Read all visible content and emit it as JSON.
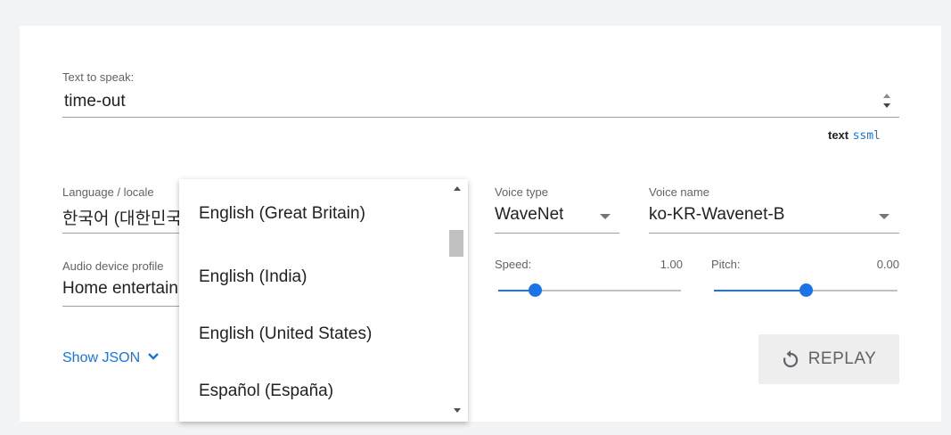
{
  "text_input": {
    "label": "Text to speak:",
    "value": "time-out",
    "mode_text": "text",
    "mode_ssml": "ssml"
  },
  "language": {
    "label": "Language / locale",
    "value": "한국어 (대한민국)"
  },
  "audio_profile": {
    "label": "Audio device profile",
    "value": "Home entertainment"
  },
  "voice_type": {
    "label": "Voice type",
    "value": "WaveNet"
  },
  "voice_name": {
    "label": "Voice name",
    "value": "ko-KR-Wavenet-B"
  },
  "speed": {
    "label": "Speed:",
    "value_text": "1.00",
    "level": 0.2
  },
  "pitch": {
    "label": "Pitch:",
    "value_text": "0.00",
    "level": 0.5
  },
  "show_json": {
    "label": "Show JSON"
  },
  "replay": {
    "label": "REPLAY"
  },
  "language_dropdown": {
    "options": [
      "English (Great Britain)",
      "English (India)",
      "English (United States)",
      "Español (España)"
    ],
    "scroll_position": 0.25
  },
  "colors": {
    "accent": "#1a73e8",
    "button_bg": "#eeeeee",
    "page_bg": "#f1f3f4"
  },
  "icons": {
    "replay": "replay-icon",
    "chevron": "chevron-down-icon"
  }
}
